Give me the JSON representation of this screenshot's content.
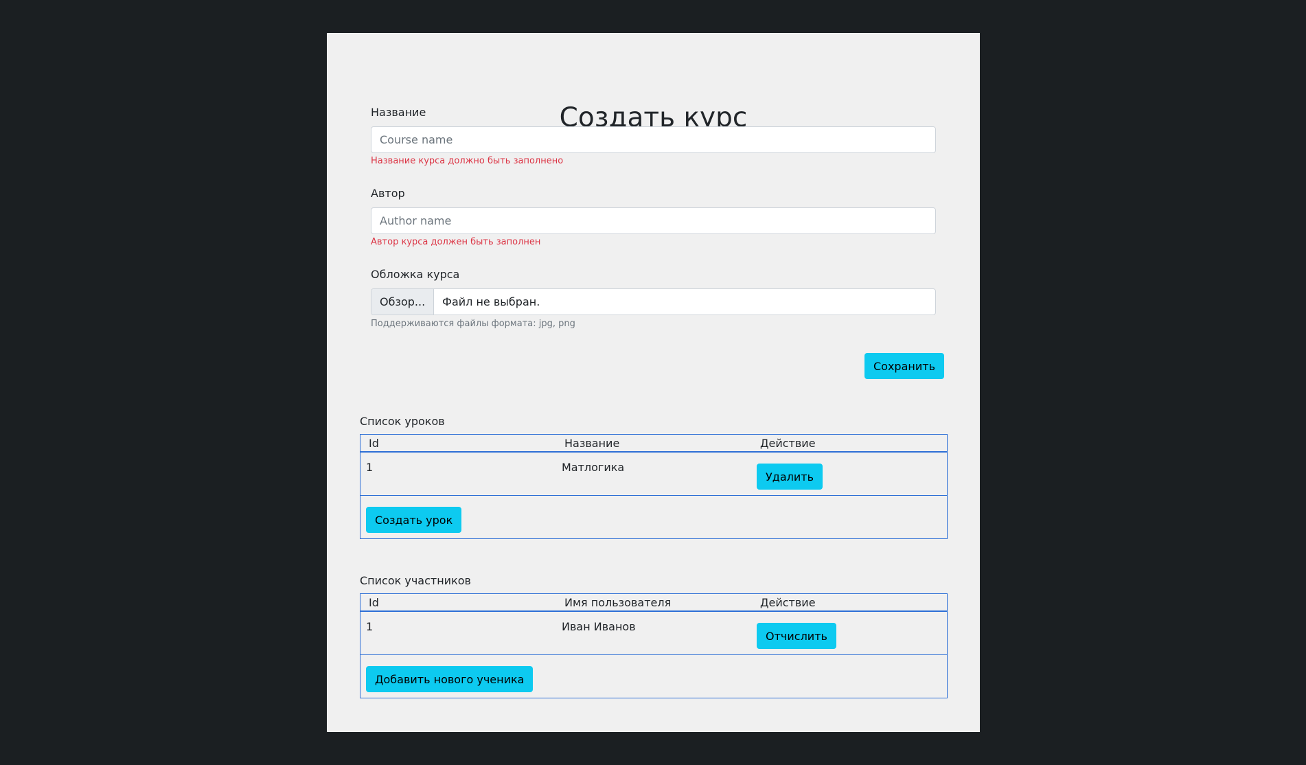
{
  "form": {
    "title": "Создать курс",
    "name_label": "Название",
    "name_placeholder": "Course name",
    "name_error": "Название курса должно быть заполнено",
    "author_label": "Автор",
    "author_placeholder": "Author name",
    "author_error": "Автор курса должен быть заполнен",
    "cover_label": "Обложка курса",
    "cover_button": "Обзор...",
    "cover_file_text": "Файл не выбран.",
    "cover_hint": "Поддерживаются файлы формата: jpg, png",
    "save_button": "Сохранить"
  },
  "lessons": {
    "title": "Список уроков",
    "columns": [
      "Id",
      "Название",
      "Действие"
    ],
    "rows": [
      {
        "id": "1",
        "name": "Матлогика",
        "action": "Удалить"
      }
    ],
    "create_button": "Создать урок"
  },
  "participants": {
    "title": "Список участников",
    "columns": [
      "Id",
      "Имя пользователя",
      "Действие"
    ],
    "rows": [
      {
        "id": "1",
        "name": "Иван Иванов",
        "action": "Отчислить"
      }
    ],
    "add_button": "Добавить нового ученика"
  },
  "colors": {
    "page_bg": "#1b1f22",
    "card_bg": "#f0f0f0",
    "accent_button": "#0dcaf0",
    "table_border": "#2d6fd6",
    "error": "#dc3545"
  }
}
